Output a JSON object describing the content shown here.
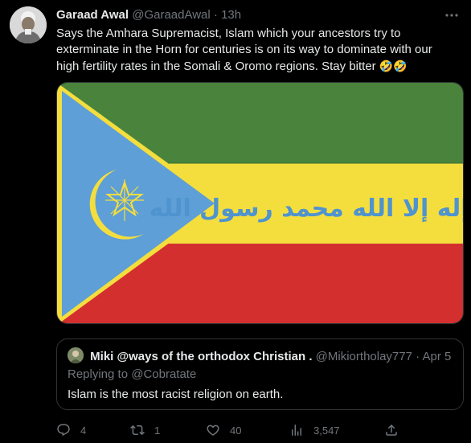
{
  "tweet": {
    "author_name": "Garaad Awal",
    "author_handle": "@GaraadAwal",
    "separator": "·",
    "time": "13h",
    "text": "Says the Amhara Supremacist, Islam which your ancestors try to exterminate in the Horn for centuries is on its way to dominate with our high fertility rates in the Somali & Oromo regions. Stay bitter",
    "emoji": "🤣🤣",
    "more_icon": "more-icon"
  },
  "media": {
    "flag_text": "لا إله إلا الله محمد رسول الله",
    "colors": {
      "green": "#4a843c",
      "yellow": "#f4de3e",
      "red": "#d32f2f",
      "blue": "#5d9fd6",
      "emblem": "#f4de3e"
    }
  },
  "quote": {
    "author_name": "Miki @ways of the orthodox Christian .",
    "author_handle": "@Mikiortholay777",
    "separator": "·",
    "time": "Apr 5",
    "reply_prefix": "Replying to",
    "reply_handle": "@Cobratate",
    "text": "Islam is the most racist religion on earth."
  },
  "actions": {
    "replies": "4",
    "retweets": "1",
    "likes": "40",
    "views": "3,547"
  },
  "colors": {
    "background": "#000000",
    "text": "#e7e9ea",
    "secondary": "#71767b",
    "border": "#2f3336"
  }
}
